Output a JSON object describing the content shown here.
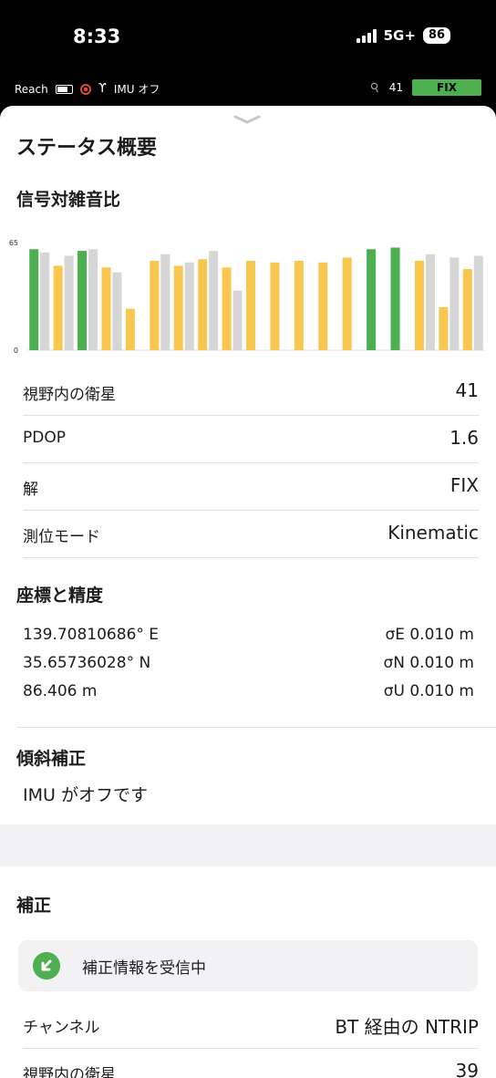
{
  "status_bar": {
    "time": "8:33",
    "network": "5G+",
    "battery": "86"
  },
  "reach_bar": {
    "device": "Reach",
    "imu": "IMU オフ",
    "satellites": "41",
    "solution": "FIX"
  },
  "sheet": {
    "title": "ステータス概要",
    "snr_title": "信号対雑音比",
    "rows": [
      {
        "label": "視野内の衛星",
        "value": "41"
      },
      {
        "label": "PDOP",
        "value": "1.6"
      },
      {
        "label": "解",
        "value": "FIX"
      },
      {
        "label": "測位モード",
        "value": "Kinematic"
      }
    ],
    "coords_title": "座標と精度",
    "coords": [
      {
        "value": "139.70810686° E",
        "accuracy": "σE 0.010 m"
      },
      {
        "value": "35.65736028° N",
        "accuracy": "σN 0.010 m"
      },
      {
        "value": "86.406 m",
        "accuracy": "σU 0.010 m"
      }
    ],
    "tilt_title": "傾斜補正",
    "tilt_text": "IMU がオフです",
    "corrections_title": "補正",
    "corrections_status": "補正情報を受信中",
    "corrections_rows": [
      {
        "label": "チャンネル",
        "value": "BT 経由の NTRIP"
      },
      {
        "label": "視野内の衛星",
        "value": "39"
      }
    ]
  },
  "colors": {
    "green": "#4caf50",
    "yellow": "#f9c74f",
    "gray": "#d6d6d6",
    "accent": "#4caf50"
  },
  "chart_data": {
    "type": "bar",
    "ylim": [
      0,
      65
    ],
    "yticks": [
      "0",
      "65"
    ],
    "groups": [
      {
        "rover": 61,
        "rover_color": "green",
        "base": 59
      },
      {
        "rover": 51,
        "rover_color": "yellow",
        "base": 57
      },
      {
        "rover": 60,
        "rover_color": "green",
        "base": 61
      },
      {
        "rover": 50,
        "rover_color": "yellow",
        "base": 47
      },
      {
        "rover": 25,
        "rover_color": "yellow",
        "base": null
      },
      {
        "rover": 54,
        "rover_color": "yellow",
        "base": 58
      },
      {
        "rover": 51,
        "rover_color": "yellow",
        "base": 53
      },
      {
        "rover": 55,
        "rover_color": "yellow",
        "base": 60
      },
      {
        "rover": 50,
        "rover_color": "yellow",
        "base": 36
      },
      {
        "rover": 54,
        "rover_color": "yellow",
        "base": null
      },
      {
        "rover": 53,
        "rover_color": "yellow",
        "base": null
      },
      {
        "rover": 54,
        "rover_color": "yellow",
        "base": null
      },
      {
        "rover": 53,
        "rover_color": "yellow",
        "base": null
      },
      {
        "rover": 56,
        "rover_color": "yellow",
        "base": null
      },
      {
        "rover": 61,
        "rover_color": "green",
        "base": null
      },
      {
        "rover": 62,
        "rover_color": "green",
        "base": null
      },
      {
        "rover": 54,
        "rover_color": "yellow",
        "base": 58
      },
      {
        "rover": 26,
        "rover_color": "yellow",
        "base": 56
      },
      {
        "rover": 49,
        "rover_color": "yellow",
        "base": 57
      }
    ]
  }
}
